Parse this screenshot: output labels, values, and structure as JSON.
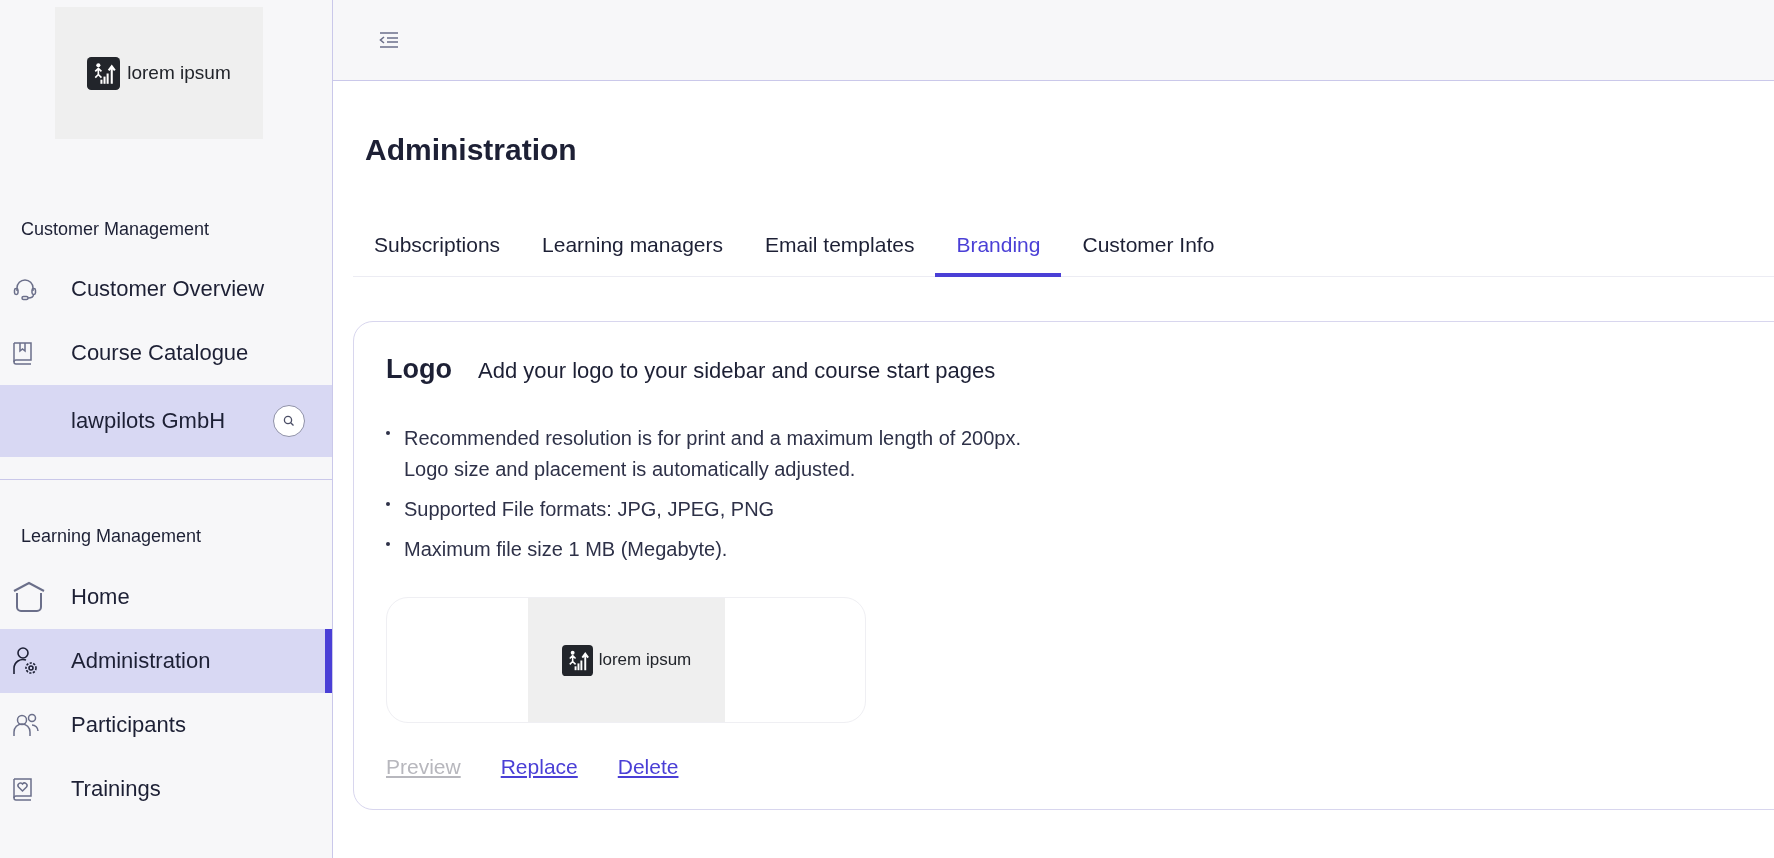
{
  "sidebar": {
    "logo": {
      "text": "lorem ipsum"
    },
    "sections": [
      {
        "title": "Customer Management",
        "items": [
          {
            "label": "Customer Overview",
            "selected": false
          },
          {
            "label": "Course Catalogue",
            "selected": false
          }
        ],
        "current_customer": {
          "name": "lawpilots GmbH"
        }
      },
      {
        "title": "Learning Management",
        "items": [
          {
            "label": "Home",
            "selected": false
          },
          {
            "label": "Administration",
            "selected": true
          },
          {
            "label": "Participants",
            "selected": false
          },
          {
            "label": "Trainings",
            "selected": false
          }
        ]
      }
    ]
  },
  "page": {
    "title": "Administration",
    "tabs": [
      {
        "label": "Subscriptions",
        "selected": false
      },
      {
        "label": "Learning managers",
        "selected": false
      },
      {
        "label": "Email templates",
        "selected": false
      },
      {
        "label": "Branding",
        "selected": true
      },
      {
        "label": "Customer Info",
        "selected": false
      }
    ],
    "card": {
      "title": "Logo",
      "subtitle": "Add your logo to your sidebar and course start pages",
      "bullets": [
        [
          "Recommended resolution is for print and a maximum length of 200px.",
          "Logo size and placement is automatically adjusted."
        ],
        [
          "Supported File formats: JPG, JPEG, PNG"
        ],
        [
          "Maximum file size 1 MB (Megabyte)."
        ]
      ],
      "preview": {
        "text": "lorem ipsum"
      },
      "actions": [
        {
          "label": "Preview",
          "disabled": true
        },
        {
          "label": "Replace",
          "disabled": false
        },
        {
          "label": "Delete",
          "disabled": false
        }
      ]
    }
  }
}
